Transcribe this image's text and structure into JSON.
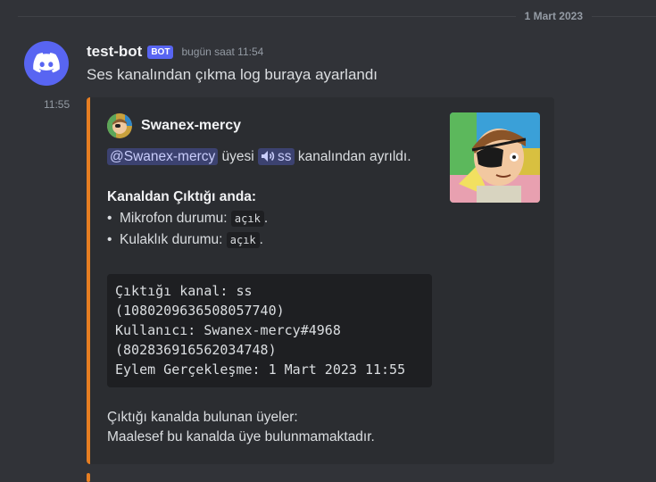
{
  "date_divider": "1 Mart 2023",
  "message": {
    "username": "test-bot",
    "bot_tag": "BOT",
    "timestamp": "bugün saat 11:54",
    "content": "Ses kanalından çıkma log buraya ayarlandı",
    "side_timestamp": "11:55"
  },
  "embed": {
    "accent_color": "#e67e22",
    "author_name": "Swanex-mercy",
    "desc_mention": "@Swanex-mercy",
    "desc_text1": " üyesi ",
    "desc_channel": "ss",
    "desc_text2": " kanalından ayrıldı.",
    "field_title": "Kanaldan Çıktığı anda:",
    "bullets": [
      {
        "label": "Mikrofon durumu: ",
        "code": "açık",
        "end": "."
      },
      {
        "label": "Kulaklık durumu: ",
        "code": "açık",
        "end": "."
      }
    ],
    "code_lines": [
      "Çıktığı kanal: ss",
      "(1080209636508057740)",
      "Kullanıcı: Swanex-mercy#4968",
      "(802836916562034748)",
      "Eylem Gerçekleşme: 1 Mart 2023 11:55"
    ],
    "footer_line1": "Çıktığı kanalda bulunan üyeler:",
    "footer_line2": "Maalesef bu kanalda üye bulunmamaktadır."
  }
}
